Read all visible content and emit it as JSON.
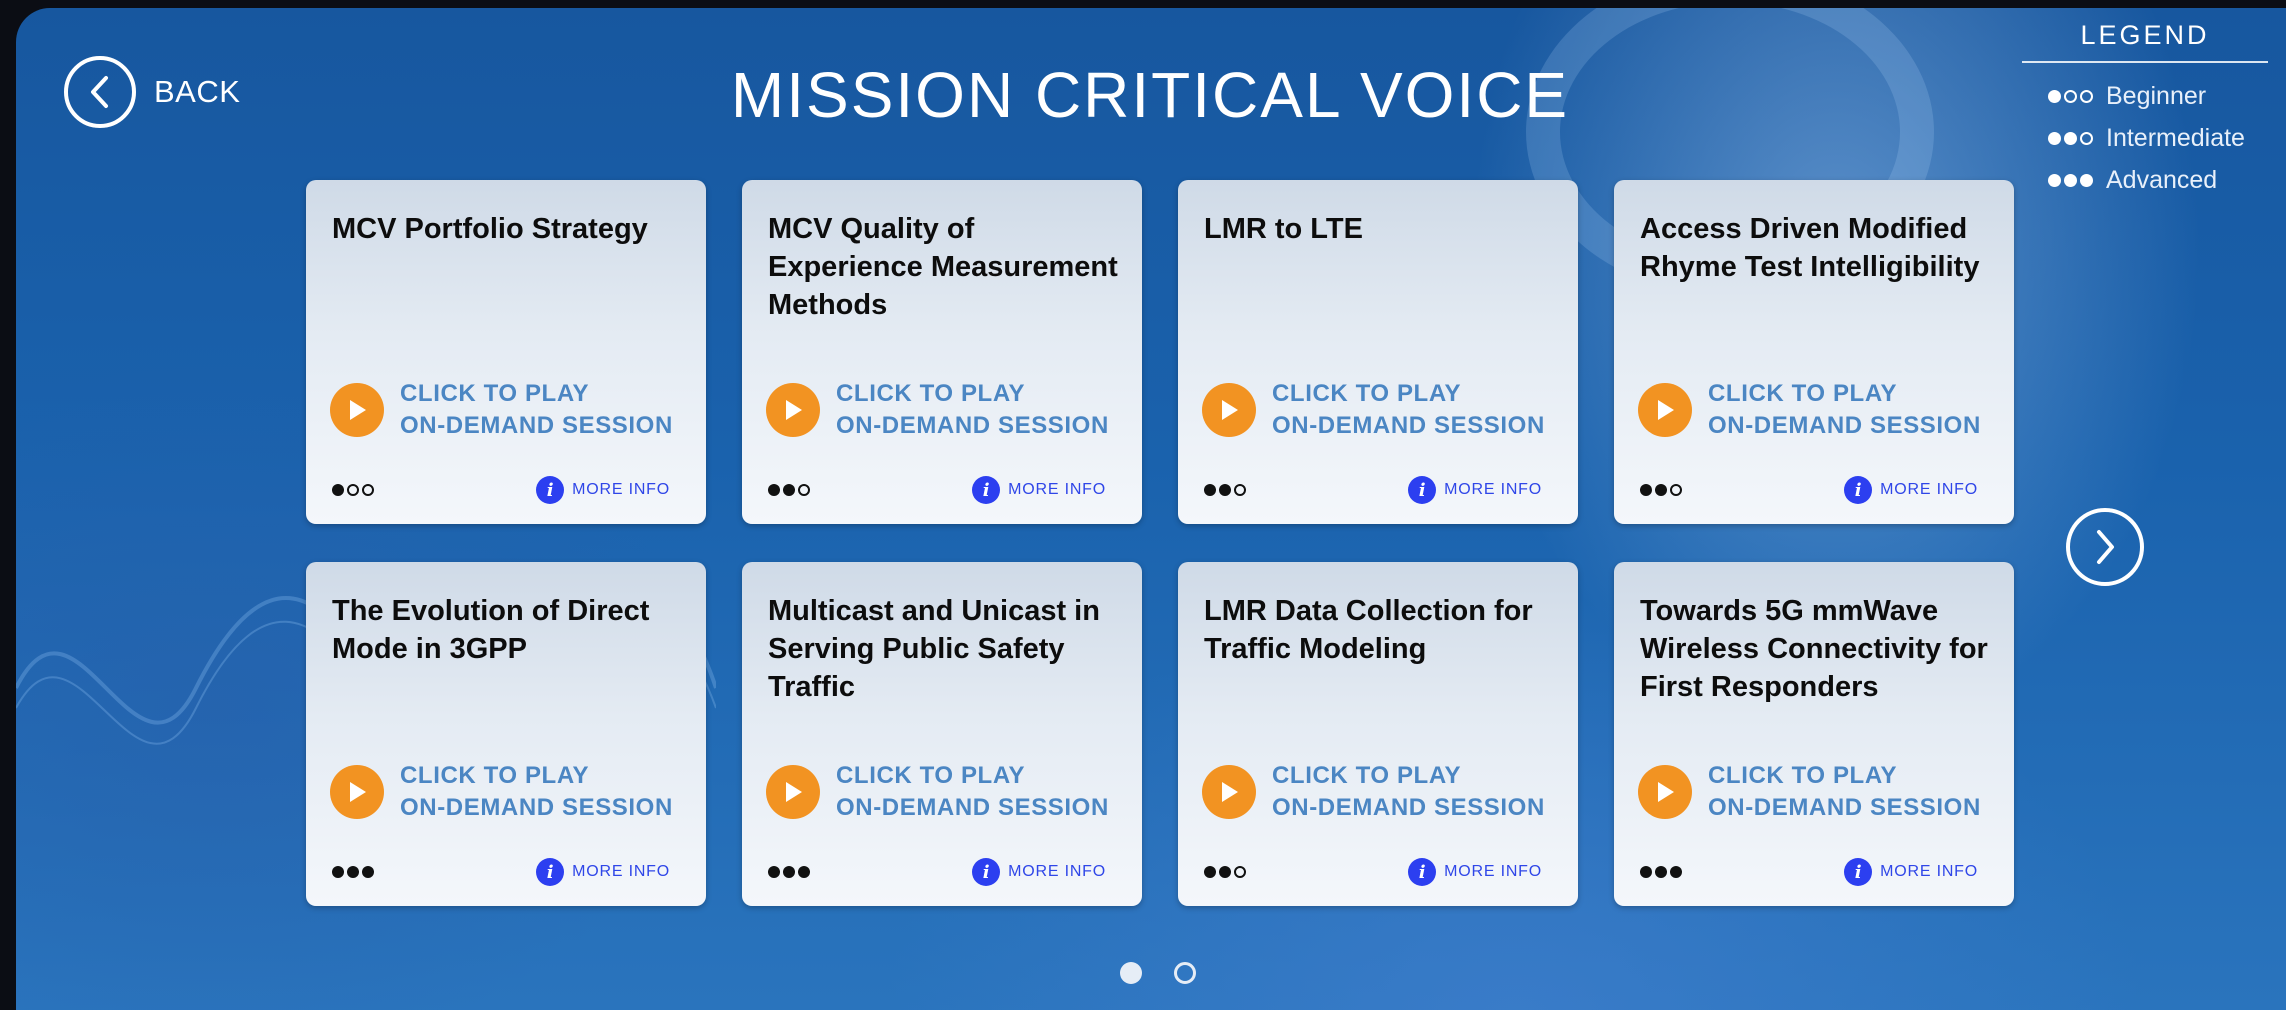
{
  "header": {
    "back_label": "BACK",
    "title": "MISSION CRITICAL VOICE"
  },
  "legend": {
    "title": "LEGEND",
    "items": [
      {
        "label": "Beginner",
        "level": 1
      },
      {
        "label": "Intermediate",
        "level": 2
      },
      {
        "label": "Advanced",
        "level": 3
      }
    ]
  },
  "cards": [
    {
      "title": "MCV Portfolio Strategy",
      "play_line1": "CLICK TO PLAY",
      "play_line2": "ON-DEMAND SESSION",
      "level": 1,
      "more_info": "MORE INFO"
    },
    {
      "title": "MCV Quality of Experience Measurement Methods",
      "play_line1": "CLICK TO PLAY",
      "play_line2": "ON-DEMAND SESSION",
      "level": 2,
      "more_info": "MORE INFO"
    },
    {
      "title": "LMR to LTE",
      "play_line1": "CLICK TO PLAY",
      "play_line2": "ON-DEMAND SESSION",
      "level": 2,
      "more_info": "MORE INFO"
    },
    {
      "title": "Access Driven Modified Rhyme Test Intelligibility",
      "play_line1": "CLICK TO PLAY",
      "play_line2": "ON-DEMAND SESSION",
      "level": 2,
      "more_info": "MORE INFO"
    },
    {
      "title": "The Evolution of Direct Mode in 3GPP",
      "play_line1": "CLICK TO PLAY",
      "play_line2": "ON-DEMAND SESSION",
      "level": 3,
      "more_info": "MORE INFO"
    },
    {
      "title": "Multicast and Unicast in Serving Public Safety Traffic",
      "play_line1": "CLICK TO PLAY",
      "play_line2": "ON-DEMAND SESSION",
      "level": 3,
      "more_info": "MORE INFO"
    },
    {
      "title": "LMR Data Collection for Traffic Modeling",
      "play_line1": "CLICK TO PLAY",
      "play_line2": "ON-DEMAND SESSION",
      "level": 2,
      "more_info": "MORE INFO"
    },
    {
      "title": "Towards 5G mmWave Wireless Connectivity for First Responders",
      "play_line1": "CLICK TO PLAY",
      "play_line2": "ON-DEMAND SESSION",
      "level": 3,
      "more_info": "MORE INFO"
    }
  ],
  "pagination": {
    "pages": 2,
    "current": 1
  },
  "icons": {
    "back": "chevron-left-icon",
    "next": "chevron-right-icon",
    "play": "play-icon",
    "info": "info-icon",
    "info_glyph": "i"
  },
  "colors": {
    "play_button": "#f29322",
    "play_text": "#4b86c3",
    "info": "#2c3ff0"
  }
}
